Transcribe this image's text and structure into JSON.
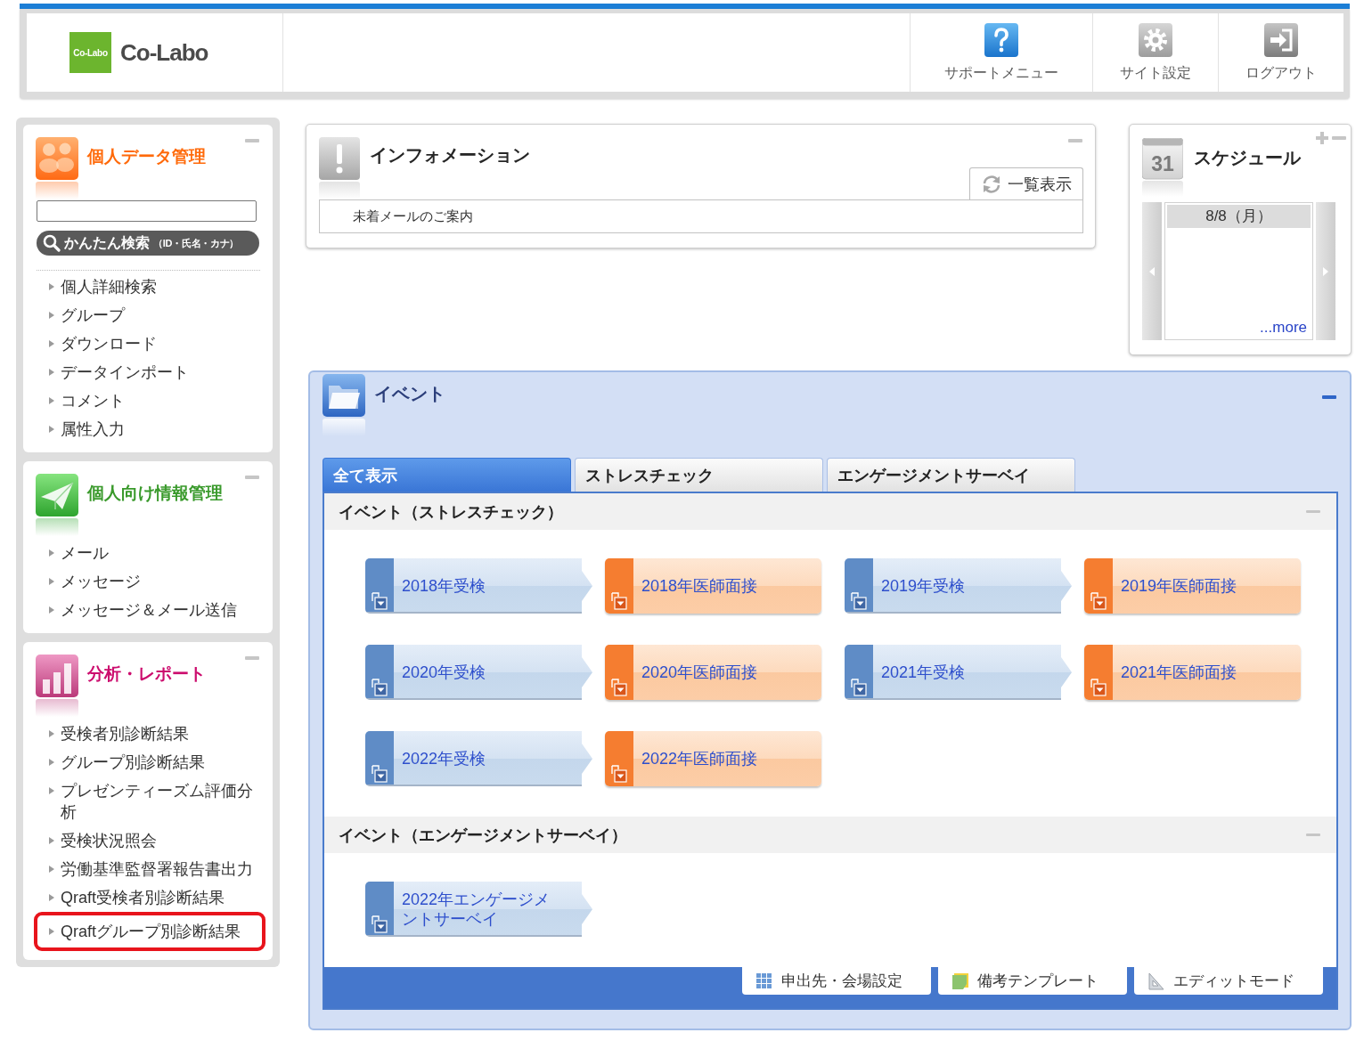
{
  "header": {
    "logo": {
      "badge": "Co-Labo",
      "name": "Co-Labo"
    },
    "nav": [
      {
        "label": "サポートメニュー",
        "kind": "help"
      },
      {
        "label": "サイト設定",
        "kind": "settings"
      },
      {
        "label": "ログアウト",
        "kind": "logout"
      }
    ]
  },
  "sidebar": {
    "panels": [
      {
        "kind": "personal",
        "title": "個人データ管理",
        "color": "#ff6a0a",
        "search": {
          "button": "かんたん検索",
          "hint": "（ID・氏名・カナ）"
        },
        "items": [
          {
            "label": "個人詳細検索",
            "highlighted": false
          },
          {
            "label": "グループ",
            "highlighted": false
          },
          {
            "label": "ダウンロード",
            "highlighted": false
          },
          {
            "label": "データインポート",
            "highlighted": false
          },
          {
            "label": "コメント",
            "highlighted": false
          },
          {
            "label": "属性入力",
            "highlighted": false
          }
        ]
      },
      {
        "kind": "mail",
        "title": "個人向け情報管理",
        "color": "#3a9a2c",
        "items": [
          {
            "label": "メール",
            "highlighted": false
          },
          {
            "label": "メッセージ",
            "highlighted": false
          },
          {
            "label": "メッセージ＆メール送信",
            "highlighted": false
          }
        ]
      },
      {
        "kind": "report",
        "title": "分析・レポート",
        "color": "#cc0d6e",
        "items": [
          {
            "label": "受検者別診断結果",
            "highlighted": false
          },
          {
            "label": "グループ別診断結果",
            "highlighted": false
          },
          {
            "label": "プレゼンティーズム評価分析",
            "highlighted": false
          },
          {
            "label": "受検状況照会",
            "highlighted": false
          },
          {
            "label": "労働基準監督署報告書出力",
            "highlighted": false
          },
          {
            "label": "Qraft受検者別診断結果",
            "highlighted": false
          },
          {
            "label": "Qraftグループ別診断結果",
            "highlighted": true
          }
        ]
      }
    ]
  },
  "information": {
    "title": "インフォメーション",
    "list_button": "一覧表示",
    "rows": [
      "未着メールのご案内"
    ]
  },
  "schedule": {
    "title": "スケジュール",
    "icon_day": "31",
    "date": "8/8（月）",
    "more_link": "...more"
  },
  "events": {
    "title": "イベント",
    "tabs": [
      {
        "label": "全て表示",
        "selected": true
      },
      {
        "label": "ストレスチェック",
        "selected": false
      },
      {
        "label": "エンゲージメントサーベイ",
        "selected": false
      }
    ],
    "sections": [
      {
        "title": "イベント（ストレスチェック）",
        "items": [
          {
            "label": "2018年受検",
            "kind": "survey"
          },
          {
            "label": "2018年医師面接",
            "kind": "interview"
          },
          {
            "label": "2019年受検",
            "kind": "survey"
          },
          {
            "label": "2019年医師面接",
            "kind": "interview"
          },
          {
            "label": "2020年受検",
            "kind": "survey"
          },
          {
            "label": "2020年医師面接",
            "kind": "interview"
          },
          {
            "label": "2021年受検",
            "kind": "survey"
          },
          {
            "label": "2021年医師面接",
            "kind": "interview"
          },
          {
            "label": "2022年受検",
            "kind": "survey"
          },
          {
            "label": "2022年医師面接",
            "kind": "interview"
          }
        ]
      },
      {
        "title": "イベント（エンゲージメントサーベイ）",
        "items": [
          {
            "label": "2022年エンゲージメントサーベイ",
            "kind": "survey"
          }
        ]
      }
    ],
    "footer_buttons": [
      {
        "label": "申出先・会場設定",
        "kind": "grid"
      },
      {
        "label": "備考テンプレート",
        "kind": "note"
      },
      {
        "label": "エディットモード",
        "kind": "edit"
      }
    ]
  }
}
